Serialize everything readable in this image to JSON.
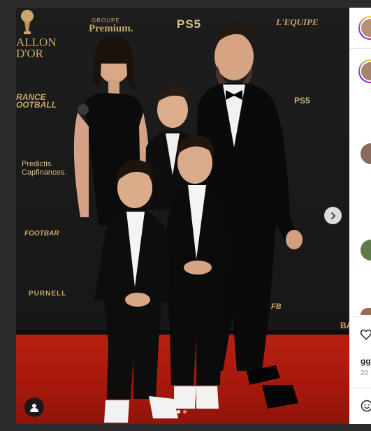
{
  "media": {
    "sponsors": {
      "groupe": "GROUPE",
      "premium": "Premium.",
      "ps5": "PS5",
      "equipe": "L'EQUIPE",
      "ballon": "ALLON\nD'OR",
      "france_football": "RANCE\nOOTBALL",
      "ps5_b": "PS5",
      "predictis": "Predictis.\nCapfinances.",
      "footbar": "FOOTBAR",
      "purnell": "PURNELL",
      "fb2": "FB",
      "ba": "BA"
    },
    "carousel": {
      "slide_count": 2,
      "active_index": 0
    }
  },
  "side": {
    "username_fragment": "gg",
    "date_fragment": "20"
  },
  "icons": {
    "next": "chevron-right-icon",
    "tag": "user-tag-icon",
    "like": "heart-icon",
    "emoji": "emoji-icon"
  },
  "colors": {
    "carpet": "#b81f12",
    "backdrop": "#1b1b1b",
    "gold": "#c9a86a"
  }
}
